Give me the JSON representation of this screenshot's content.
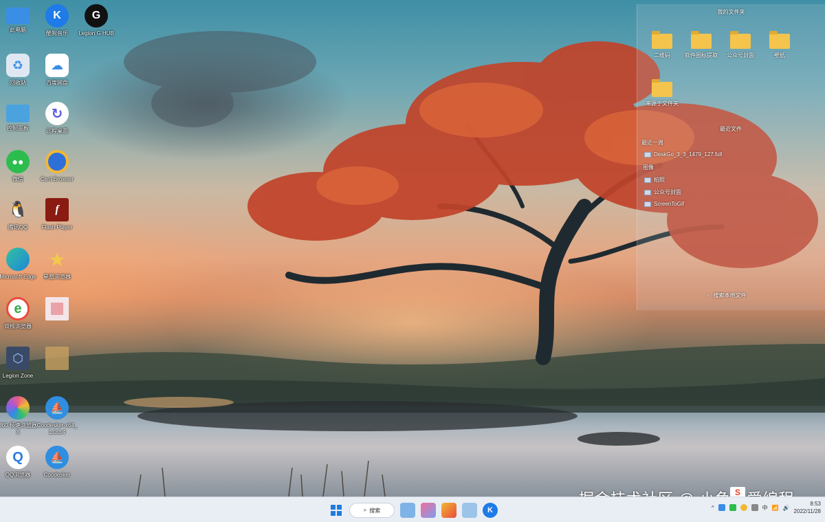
{
  "desktop_icons": [
    {
      "id": "this-pc",
      "label": "此电脑",
      "icon": "monitor-icon",
      "color": "#3a8ee6"
    },
    {
      "id": "kugou",
      "label": "酷狗音乐",
      "icon": "k-logo-icon",
      "color": "#1e7be8",
      "glyph": "K"
    },
    {
      "id": "legion-hub",
      "label": "Legion G HUB",
      "icon": "g-logo-icon",
      "color": "#111111",
      "glyph": "G"
    },
    {
      "id": "recycle-bin",
      "label": "回收站",
      "icon": "recycle-bin-icon",
      "color": "#dfe8f2"
    },
    {
      "id": "baidu-pan",
      "label": "百度网盘",
      "icon": "cloud-icon",
      "color": "#ffffff"
    },
    {
      "id": "control-panel",
      "label": "控制面板",
      "icon": "control-panel-icon",
      "color": "#4aa3df"
    },
    {
      "id": "remote",
      "label": "远程桌面",
      "icon": "refresh-circle-icon",
      "color": "#5b5be0"
    },
    {
      "id": "wechat",
      "label": "微信",
      "icon": "chat-icon",
      "color": "#2dbd4e"
    },
    {
      "id": "cent-browser",
      "label": "Cent Browser",
      "icon": "browser-icon",
      "color": "#2f6fd8"
    },
    {
      "id": "qq",
      "label": "腾讯QQ",
      "icon": "penguin-icon",
      "color": "#111111"
    },
    {
      "id": "flash-player",
      "label": "Flash Player",
      "icon": "flash-icon",
      "color": "#8a1b12",
      "glyph": "f"
    },
    {
      "id": "edge",
      "label": "Microsoft Edge",
      "icon": "edge-icon",
      "color": "#1c87d8"
    },
    {
      "id": "star-browser",
      "label": "星愿浏览器",
      "icon": "star-icon",
      "color": "#f2c94c",
      "glyph": "★"
    },
    {
      "id": "ie-browser",
      "label": "双核浏览器",
      "icon": "e-browser-icon",
      "color": "#3aa84a",
      "glyph": "e"
    },
    {
      "id": "blurred-1",
      "label": "",
      "icon": "blurred-app-icon",
      "color": "#e9a3a8"
    },
    {
      "id": "legion-zone",
      "label": "Legion Zone",
      "icon": "cube-icon",
      "color": "#3a4a66"
    },
    {
      "id": "blurred-2",
      "label": "",
      "icon": "blurred-app-icon",
      "color": "#c8a060"
    },
    {
      "id": "360-browser",
      "label": "360 极速浏览器X",
      "icon": "rainbow-circle-icon",
      "color": "#e65a8a"
    },
    {
      "id": "coodesker-x64",
      "label": "Coodesker-x64_1.0.3.4",
      "icon": "sailboat-icon",
      "color": "#2f8ee0"
    },
    {
      "id": "qq-browser",
      "label": "QQ浏览器",
      "icon": "q-browser-icon",
      "color": "#2a7de1",
      "glyph": "Q"
    },
    {
      "id": "coodesker",
      "label": "Coodesker",
      "icon": "sailboat-icon",
      "color": "#2f8ee0"
    }
  ],
  "panel": {
    "title": "我的文件夹",
    "folders": [
      {
        "label": "二维码"
      },
      {
        "label": "软件图标提取"
      },
      {
        "label": "公众号封面"
      },
      {
        "label": "壁纸"
      },
      {
        "label": "来源于文件夹"
      }
    ],
    "recent_title": "最近文件",
    "recent_sub": "最近一周",
    "recent_items": [
      {
        "label": "DeskGo_3_3_1479_127.full",
        "icon": "file-icon"
      },
      {
        "label": "图像",
        "icon": ""
      },
      {
        "label": "拍照",
        "icon": "file-icon"
      },
      {
        "label": "公众号封面",
        "icon": "file-icon"
      },
      {
        "label": "ScreenToGif",
        "icon": "file-icon"
      }
    ],
    "search_local": "搜索本地文件"
  },
  "taskbar": {
    "search_label": "搜索",
    "clock_time": "8:53",
    "clock_date": "2022/11/28",
    "ime_label": "S",
    "tray_lang": "中"
  },
  "watermark": "掘金技术社区 @ 小鱼人爱编程"
}
